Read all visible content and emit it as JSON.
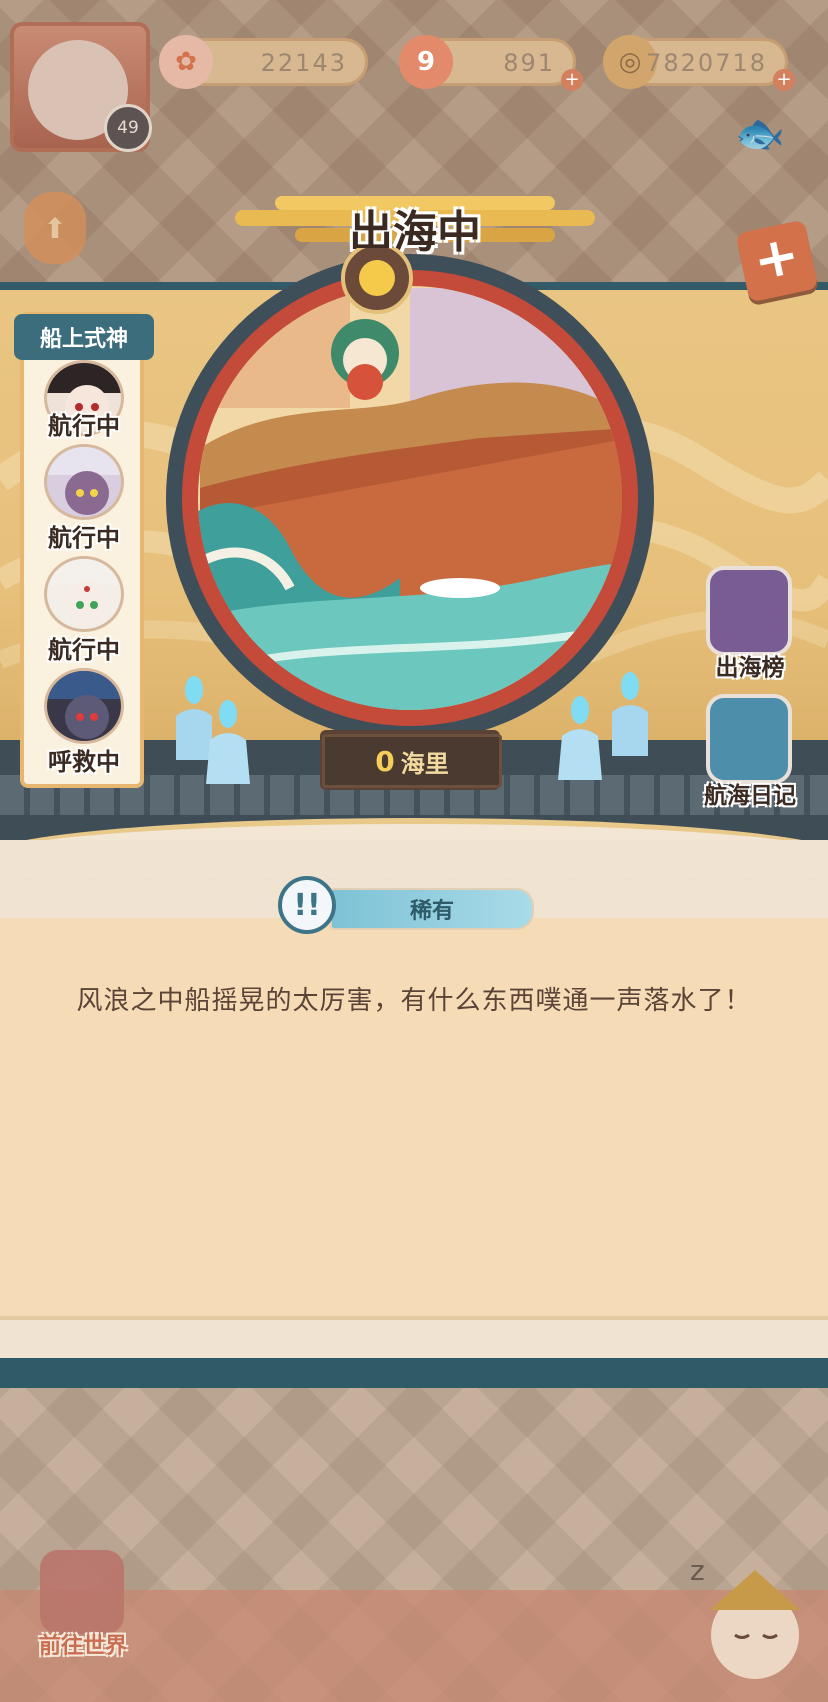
{
  "status": {
    "level": "49",
    "resource_1": "22143",
    "resource_2": "891",
    "resource_3": "7820718"
  },
  "title": "出海中",
  "crew": {
    "tab_label": "船上式神",
    "members": [
      {
        "status": "航行中"
      },
      {
        "status": "航行中"
      },
      {
        "status": "航行中"
      },
      {
        "status": "呼救中"
      }
    ]
  },
  "distance": {
    "value": "0",
    "unit": "海里"
  },
  "side_buttons": {
    "leaderboard": "出海榜",
    "diary": "航海日记"
  },
  "event": {
    "rarity": "稀有",
    "text": "风浪之中船摇晃的太厉害，有什么东西噗通一声落水了！"
  },
  "bottom": {
    "world_button": "前往世界"
  },
  "colors": {
    "teal": "#2f5a67",
    "cream_panel": "#f6dcb6",
    "accent_orange": "#d3714a",
    "distance_yellow": "#f5cf5a"
  }
}
